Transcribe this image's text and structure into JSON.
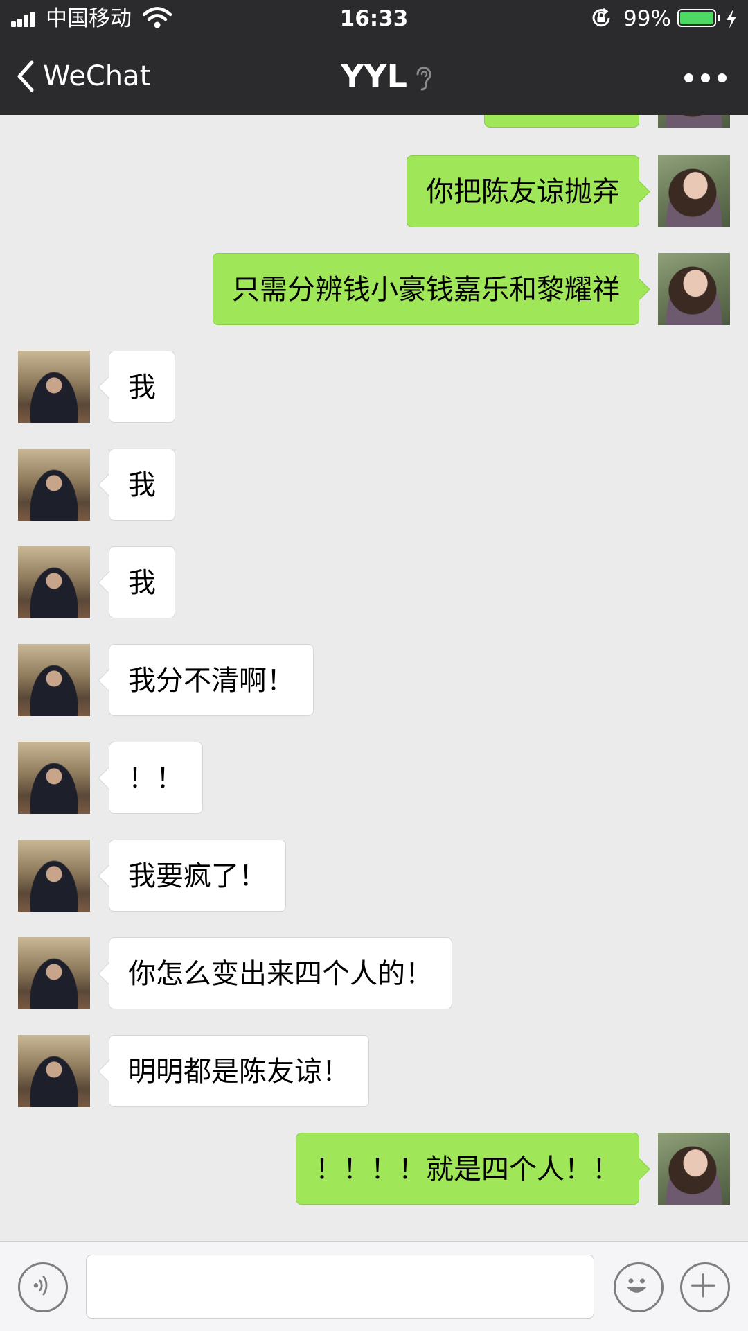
{
  "status_bar": {
    "carrier": "中国移动",
    "time": "16:33",
    "battery_percent": "99%",
    "battery_level": 0.99,
    "icons": [
      "signal-icon",
      "wifi-icon",
      "orientation-lock-icon",
      "battery-icon",
      "charging-icon"
    ]
  },
  "nav": {
    "back_label": "WeChat",
    "title": "YYL",
    "icons": [
      "chevron-left-icon",
      "ear-icon",
      "more-icon"
    ]
  },
  "messages": [
    {
      "sender": "self",
      "text": ""
    },
    {
      "sender": "self",
      "text": "你把陈友谅抛弃"
    },
    {
      "sender": "self",
      "text": "只需分辨钱小豪钱嘉乐和黎耀祥"
    },
    {
      "sender": "other",
      "text": "我"
    },
    {
      "sender": "other",
      "text": "我"
    },
    {
      "sender": "other",
      "text": "我"
    },
    {
      "sender": "other",
      "text": "我分不清啊！"
    },
    {
      "sender": "other",
      "text": "！！"
    },
    {
      "sender": "other",
      "text": "我要疯了！"
    },
    {
      "sender": "other",
      "text": "你怎么变出来四个人的！"
    },
    {
      "sender": "other",
      "text": "明明都是陈友谅！"
    },
    {
      "sender": "self",
      "text": "！！！！就是四个人！！"
    }
  ],
  "input_bar": {
    "value": "",
    "placeholder": "",
    "icons": [
      "voice-icon",
      "emoji-icon",
      "plus-icon"
    ]
  },
  "colors": {
    "bar_background": "#2b2b2d",
    "chat_background": "#ebebeb",
    "self_bubble": "#9fe658",
    "other_bubble": "#ffffff",
    "battery_fill": "#4cd964"
  }
}
